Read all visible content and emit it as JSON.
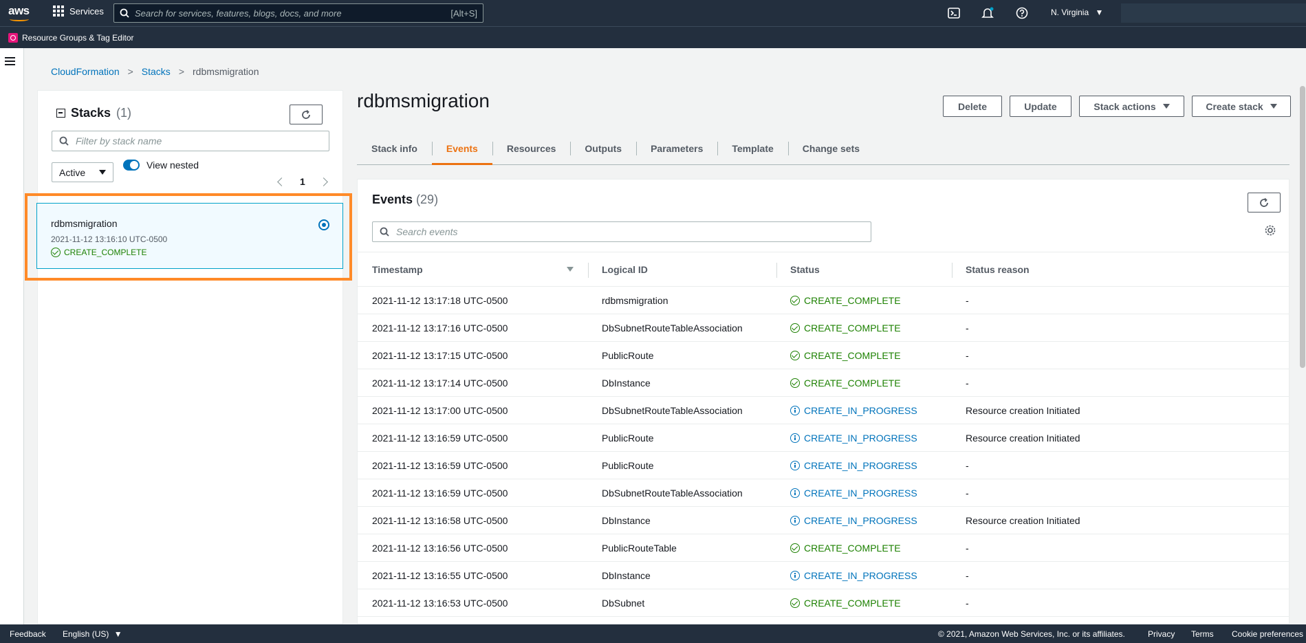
{
  "topnav": {
    "logo_text": "aws",
    "services_label": "Services",
    "search_placeholder": "Search for services, features, blogs, docs, and more",
    "search_shortcut": "[Alt+S]",
    "region": "N. Virginia",
    "accent_color": "#ff9900"
  },
  "subnav": {
    "pinned_service": "Resource Groups & Tag Editor"
  },
  "breadcrumb": {
    "items": [
      "CloudFormation",
      "Stacks",
      "rdbmsmigration"
    ]
  },
  "stacks_panel": {
    "title": "Stacks",
    "count": "(1)",
    "filter_placeholder": "Filter by stack name",
    "status_filter": "Active",
    "view_nested_label": "View nested",
    "view_nested_on": true,
    "page": "1",
    "stacks": [
      {
        "name": "rdbmsmigration",
        "created": "2021-11-12 13:16:10 UTC-0500",
        "status": "CREATE_COMPLETE",
        "selected": true
      }
    ]
  },
  "main": {
    "title": "rdbmsmigration",
    "buttons": {
      "delete": "Delete",
      "update": "Update",
      "stack_actions": "Stack actions",
      "create_stack": "Create stack"
    },
    "tabs": [
      "Stack info",
      "Events",
      "Resources",
      "Outputs",
      "Parameters",
      "Template",
      "Change sets"
    ],
    "active_tab": "Events"
  },
  "events": {
    "title": "Events",
    "count": "(29)",
    "search_placeholder": "Search events",
    "columns": [
      "Timestamp",
      "Logical ID",
      "Status",
      "Status reason"
    ],
    "rows": [
      {
        "timestamp": "2021-11-12 13:17:18 UTC-0500",
        "logical_id": "rdbmsmigration",
        "status": "CREATE_COMPLETE",
        "reason": "-"
      },
      {
        "timestamp": "2021-11-12 13:17:16 UTC-0500",
        "logical_id": "DbSubnetRouteTableAssociation",
        "status": "CREATE_COMPLETE",
        "reason": "-"
      },
      {
        "timestamp": "2021-11-12 13:17:15 UTC-0500",
        "logical_id": "PublicRoute",
        "status": "CREATE_COMPLETE",
        "reason": "-"
      },
      {
        "timestamp": "2021-11-12 13:17:14 UTC-0500",
        "logical_id": "DbInstance",
        "status": "CREATE_COMPLETE",
        "reason": "-"
      },
      {
        "timestamp": "2021-11-12 13:17:00 UTC-0500",
        "logical_id": "DbSubnetRouteTableAssociation",
        "status": "CREATE_IN_PROGRESS",
        "reason": "Resource creation Initiated"
      },
      {
        "timestamp": "2021-11-12 13:16:59 UTC-0500",
        "logical_id": "PublicRoute",
        "status": "CREATE_IN_PROGRESS",
        "reason": "Resource creation Initiated"
      },
      {
        "timestamp": "2021-11-12 13:16:59 UTC-0500",
        "logical_id": "PublicRoute",
        "status": "CREATE_IN_PROGRESS",
        "reason": "-"
      },
      {
        "timestamp": "2021-11-12 13:16:59 UTC-0500",
        "logical_id": "DbSubnetRouteTableAssociation",
        "status": "CREATE_IN_PROGRESS",
        "reason": "-"
      },
      {
        "timestamp": "2021-11-12 13:16:58 UTC-0500",
        "logical_id": "DbInstance",
        "status": "CREATE_IN_PROGRESS",
        "reason": "Resource creation Initiated"
      },
      {
        "timestamp": "2021-11-12 13:16:56 UTC-0500",
        "logical_id": "PublicRouteTable",
        "status": "CREATE_COMPLETE",
        "reason": "-"
      },
      {
        "timestamp": "2021-11-12 13:16:55 UTC-0500",
        "logical_id": "DbInstance",
        "status": "CREATE_IN_PROGRESS",
        "reason": "-"
      },
      {
        "timestamp": "2021-11-12 13:16:53 UTC-0500",
        "logical_id": "DbSubnet",
        "status": "CREATE_COMPLETE",
        "reason": "-"
      }
    ]
  },
  "footer": {
    "feedback": "Feedback",
    "language": "English (US)",
    "copyright": "© 2021, Amazon Web Services, Inc. or its affiliates.",
    "privacy": "Privacy",
    "terms": "Terms",
    "cookies": "Cookie preferences"
  }
}
